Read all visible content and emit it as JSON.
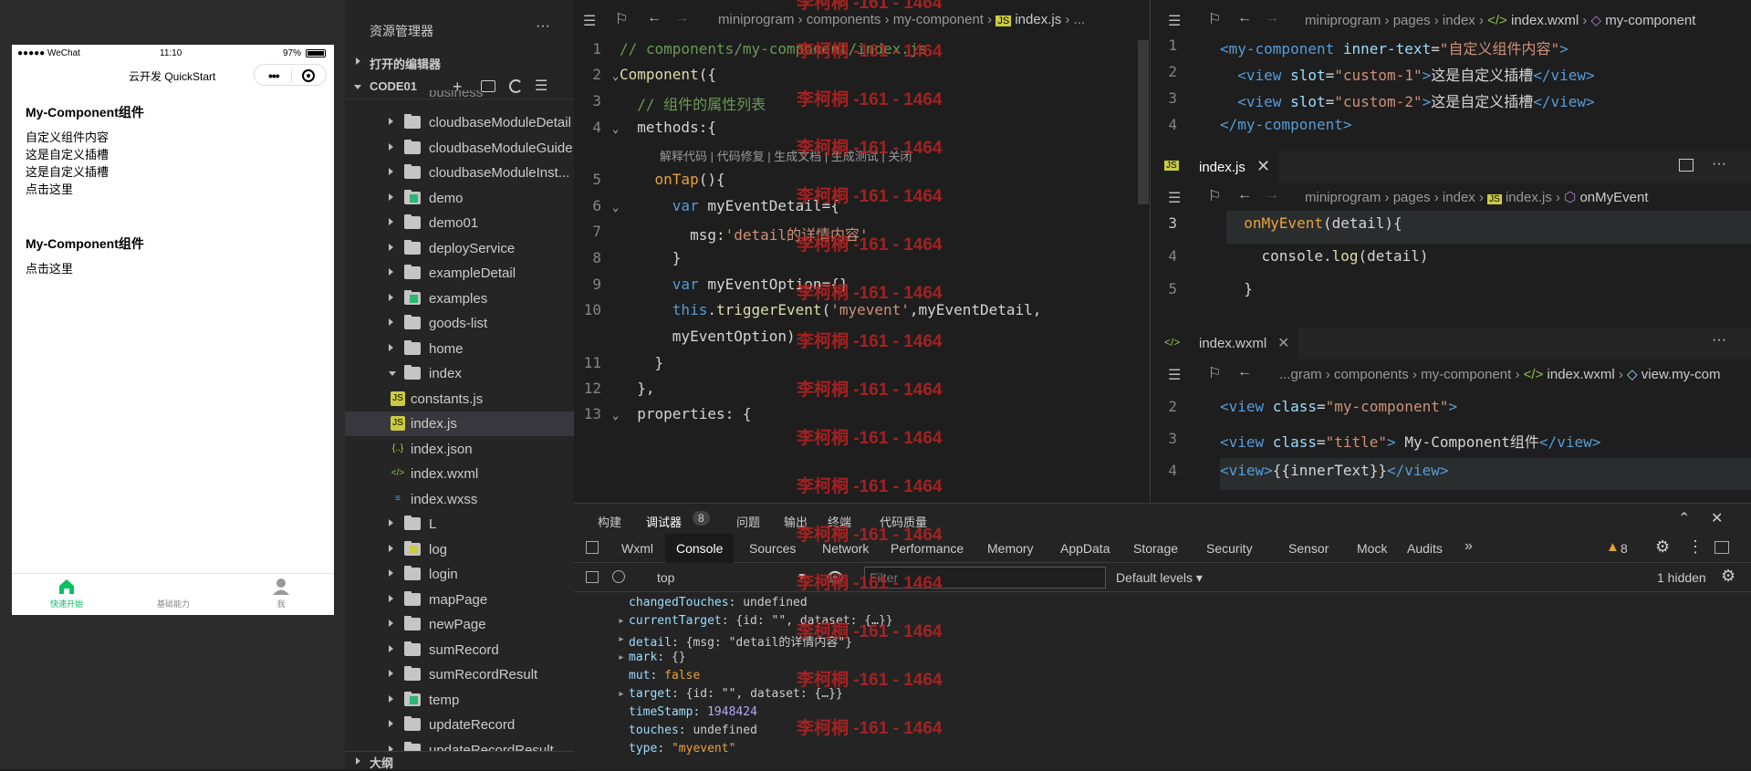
{
  "simulator": {
    "status_carrier": "●●●●● WeChat",
    "status_time": "11:10",
    "status_battery": "97%",
    "nav_title": "云开发 QuickStart",
    "content": [
      {
        "title": "My-Component组件",
        "lines": [
          "自定义组件内容",
          "这是自定义插槽",
          "这是自定义插槽",
          "点击这里"
        ]
      },
      {
        "title": "My-Component组件",
        "lines": [
          "点击这里"
        ]
      }
    ],
    "tabs": [
      {
        "label": "快速开始",
        "color": "#07c160"
      },
      {
        "label": "基础能力",
        "color": "#888888"
      },
      {
        "label": "我",
        "color": "#888888"
      }
    ]
  },
  "explorer": {
    "title": "资源管理器",
    "more": "···",
    "open_editors": "打开的编辑器",
    "root": "CODE01",
    "cut_top": "business",
    "items": [
      {
        "label": "cloudbaseModuleDetail",
        "type": "folder"
      },
      {
        "label": "cloudbaseModuleGuide",
        "type": "folder"
      },
      {
        "label": "cloudbaseModuleInst...",
        "type": "folder"
      },
      {
        "label": "demo",
        "type": "folder-g"
      },
      {
        "label": "demo01",
        "type": "folder"
      },
      {
        "label": "deployService",
        "type": "folder"
      },
      {
        "label": "exampleDetail",
        "type": "folder"
      },
      {
        "label": "examples",
        "type": "folder-g"
      },
      {
        "label": "goods-list",
        "type": "folder"
      },
      {
        "label": "home",
        "type": "folder"
      },
      {
        "label": "index",
        "type": "folder-open"
      },
      {
        "label": "constants.js",
        "type": "js"
      },
      {
        "label": "index.js",
        "type": "js",
        "selected": true
      },
      {
        "label": "index.json",
        "type": "json"
      },
      {
        "label": "index.wxml",
        "type": "wxml"
      },
      {
        "label": "index.wxss",
        "type": "wxss"
      },
      {
        "label": "L",
        "type": "folder"
      },
      {
        "label": "log",
        "type": "folder-y"
      },
      {
        "label": "login",
        "type": "folder"
      },
      {
        "label": "mapPage",
        "type": "folder"
      },
      {
        "label": "newPage",
        "type": "folder"
      },
      {
        "label": "sumRecord",
        "type": "folder"
      },
      {
        "label": "sumRecordResult",
        "type": "folder"
      },
      {
        "label": "temp",
        "type": "folder-g"
      },
      {
        "label": "updateRecord",
        "type": "folder"
      },
      {
        "label": "updateRecordResult",
        "type": "folder"
      }
    ],
    "outline": "大纲"
  },
  "editor_main": {
    "breadcrumb": [
      "miniprogram",
      "components",
      "my-component",
      "index.js",
      "..."
    ],
    "codelens": "解释代码 | 代码修复 | 生成文档 | 生成测试 | 关闭",
    "lines": [
      {
        "n": "1",
        "parts": [
          [
            "cm",
            "// components/my-component/index.js"
          ]
        ]
      },
      {
        "n": "2",
        "parts": [
          [
            "fn",
            "Component"
          ],
          [
            "pl",
            "({"
          ]
        ]
      },
      {
        "n": "3",
        "parts": [
          [
            "pl",
            "  "
          ],
          [
            "cm",
            "// 组件的属性列表"
          ]
        ]
      },
      {
        "n": "4",
        "parts": [
          [
            "pl",
            "  methods:{"
          ]
        ]
      },
      {
        "n": "5",
        "parts": [
          [
            "pl",
            "    "
          ],
          [
            "orn",
            "onTap"
          ],
          [
            "pl",
            "(){"
          ]
        ]
      },
      {
        "n": "6",
        "parts": [
          [
            "pl",
            "      "
          ],
          [
            "kw",
            "var"
          ],
          [
            "pl",
            " myEventDetail={"
          ]
        ]
      },
      {
        "n": "7",
        "parts": [
          [
            "pl",
            "        msg:"
          ],
          [
            "str",
            "'detail的详情内容'"
          ]
        ]
      },
      {
        "n": "8",
        "parts": [
          [
            "pl",
            "      }"
          ]
        ]
      },
      {
        "n": "9",
        "parts": [
          [
            "pl",
            "      "
          ],
          [
            "kw",
            "var"
          ],
          [
            "pl",
            " myEventOption={}"
          ]
        ]
      },
      {
        "n": "10",
        "parts": [
          [
            "pl",
            "      "
          ],
          [
            "kw",
            "this"
          ],
          [
            "pl",
            "."
          ],
          [
            "fn",
            "triggerEvent"
          ],
          [
            "pl",
            "("
          ],
          [
            "str",
            "'myevent'"
          ],
          [
            "pl",
            ",myEventDetail,"
          ]
        ]
      },
      {
        "n": "",
        "parts": [
          [
            "pl",
            "      myEventOption)"
          ]
        ]
      },
      {
        "n": "11",
        "parts": [
          [
            "pl",
            "    }"
          ]
        ]
      },
      {
        "n": "12",
        "parts": [
          [
            "pl",
            "  },"
          ]
        ]
      },
      {
        "n": "13",
        "parts": [
          [
            "pl",
            "  properties: {"
          ]
        ]
      }
    ]
  },
  "editor_right1": {
    "breadcrumb": [
      "miniprogram",
      "pages",
      "index",
      "index.wxml",
      "my-component"
    ],
    "lines": [
      {
        "n": "1",
        "parts": [
          [
            "tag",
            "<my-component"
          ],
          [
            "attr",
            " inner-text"
          ],
          [
            "pl",
            "="
          ],
          [
            "str",
            "\"自定义组件内容\""
          ],
          [
            "tag",
            ">"
          ]
        ]
      },
      {
        "n": "2",
        "parts": [
          [
            "pl",
            "  "
          ],
          [
            "tag",
            "<view"
          ],
          [
            "attr",
            " slot"
          ],
          [
            "pl",
            "="
          ],
          [
            "str",
            "\"custom-1\""
          ],
          [
            "tag",
            ">"
          ],
          [
            "pl",
            "这是自定义插槽"
          ],
          [
            "tag",
            "</view>"
          ]
        ]
      },
      {
        "n": "3",
        "parts": [
          [
            "pl",
            "  "
          ],
          [
            "tag",
            "<view"
          ],
          [
            "attr",
            " slot"
          ],
          [
            "pl",
            "="
          ],
          [
            "str",
            "\"custom-2\""
          ],
          [
            "tag",
            ">"
          ],
          [
            "pl",
            "这是自定义插槽"
          ],
          [
            "tag",
            "</view>"
          ]
        ]
      },
      {
        "n": "4",
        "parts": [
          [
            "tag",
            "</my-component>"
          ]
        ]
      }
    ]
  },
  "editor_right2": {
    "tab": "index.js",
    "breadcrumb": [
      "miniprogram",
      "pages",
      "index",
      "index.js",
      "onMyEvent"
    ],
    "lines": [
      {
        "n": "3",
        "parts": [
          [
            "pl",
            "  "
          ],
          [
            "orn",
            "onMyEvent"
          ],
          [
            "pl",
            "(detail){"
          ]
        ]
      },
      {
        "n": "4",
        "parts": [
          [
            "pl",
            "    console."
          ],
          [
            "fn",
            "log"
          ],
          [
            "pl",
            "(detail)"
          ]
        ]
      },
      {
        "n": "5",
        "parts": [
          [
            "pl",
            "  }"
          ]
        ]
      }
    ]
  },
  "editor_right3": {
    "tab": "index.wxml",
    "breadcrumb": [
      "...gram",
      "components",
      "my-component",
      "index.wxml",
      "view.my-com"
    ],
    "lines": [
      {
        "n": "2",
        "parts": [
          [
            "tag",
            "<view"
          ],
          [
            "attr",
            " class"
          ],
          [
            "pl",
            "="
          ],
          [
            "str",
            "\"my-component\""
          ],
          [
            "tag",
            ">"
          ]
        ]
      },
      {
        "n": "3",
        "parts": [
          [
            "tag",
            "<view"
          ],
          [
            "attr",
            " class"
          ],
          [
            "pl",
            "="
          ],
          [
            "str",
            "\"title\""
          ],
          [
            "tag",
            ">"
          ],
          [
            "pl",
            " My-Component组件"
          ],
          [
            "tag",
            "</view>"
          ]
        ]
      },
      {
        "n": "4",
        "parts": [
          [
            "tag",
            "<view>"
          ],
          [
            "pl",
            "{{innerText}}"
          ],
          [
            "tag",
            "</view>"
          ]
        ]
      }
    ]
  },
  "watermark": "李柯桐 -161 - 1464",
  "devtools": {
    "panel_tabs": [
      "构建",
      "调试器",
      "问题",
      "输出",
      "终端",
      "代码质量"
    ],
    "debugger_badge": "8",
    "tabs": [
      "Wxml",
      "Console",
      "Sources",
      "Network",
      "Performance",
      "Memory",
      "AppData",
      "Storage",
      "Security",
      "Sensor",
      "Mock",
      "Audits"
    ],
    "more_tabs": "»",
    "warn_count": "8",
    "context": "top",
    "filter_placeholder": "Filter",
    "levels": "Default levels ▾",
    "hidden": "1 hidden",
    "console_lines": [
      {
        "exp": false,
        "key": "changedTouches",
        "val": "undefined",
        "kind": "cv"
      },
      {
        "exp": true,
        "key": "currentTarget",
        "val": "{id: \"\", dataset: {…}}",
        "kind": "cv"
      },
      {
        "exp": true,
        "key": "detail",
        "val": "{msg: \"detail的详情内容\"}",
        "kind": "cv"
      },
      {
        "exp": true,
        "key": "mark",
        "val": "{}",
        "kind": "cv"
      },
      {
        "exp": false,
        "key": "mut",
        "val": "false",
        "kind": "cs"
      },
      {
        "exp": true,
        "key": "target",
        "val": "{id: \"\", dataset: {…}}",
        "kind": "cv"
      },
      {
        "exp": false,
        "key": "timeStamp",
        "val": "1948424",
        "kind": "cn"
      },
      {
        "exp": false,
        "key": "touches",
        "val": "undefined",
        "kind": "cv"
      },
      {
        "exp": false,
        "key": "type",
        "val": "\"myevent\"",
        "kind": "cs"
      }
    ]
  }
}
